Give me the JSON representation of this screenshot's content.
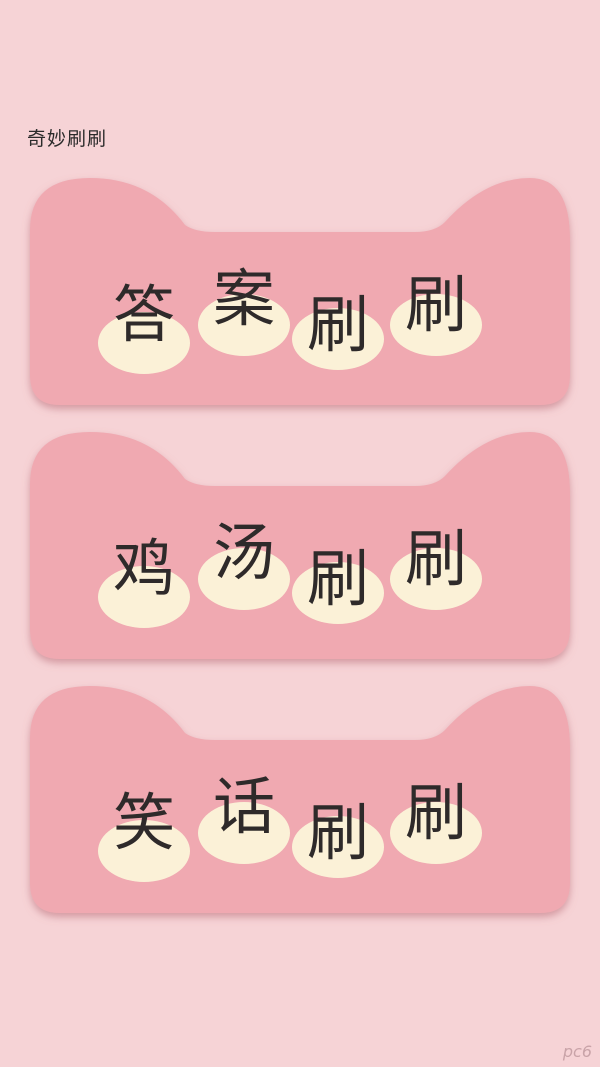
{
  "app": {
    "title": "奇妙刷刷"
  },
  "cards": [
    {
      "chars": [
        "答",
        "案",
        "刷",
        "刷"
      ]
    },
    {
      "chars": [
        "鸡",
        "汤",
        "刷",
        "刷"
      ]
    },
    {
      "chars": [
        "笑",
        "话",
        "刷",
        "刷"
      ]
    }
  ],
  "watermark": "pc6",
  "colors": {
    "background": "#f6d3d6",
    "card": "#f0a9b1",
    "card_shadow": "#c97882",
    "blob": "#fbf1d7",
    "text": "#2e2a2a"
  }
}
